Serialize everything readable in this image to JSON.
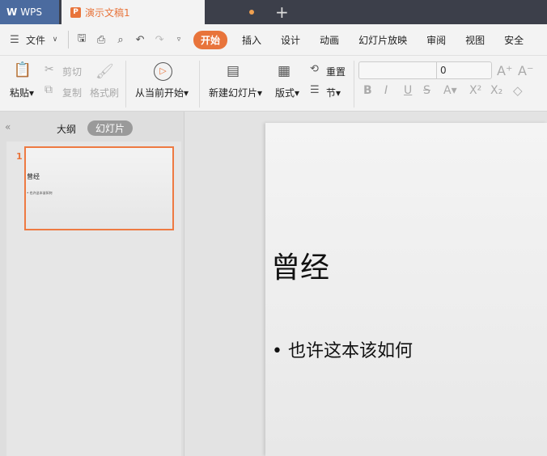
{
  "tabs": {
    "app": "WPS",
    "document": "演示文稿1",
    "new_tab": "+"
  },
  "menu": {
    "file": "文件",
    "items": [
      "开始",
      "插入",
      "设计",
      "动画",
      "幻灯片放映",
      "审阅",
      "视图",
      "安全"
    ]
  },
  "ribbon": {
    "paste": "粘贴",
    "cut": "剪切",
    "copy": "复制",
    "format_painter": "格式刷",
    "play_from_current": "从当前开始",
    "new_slide": "新建幻灯片",
    "layout": "版式",
    "reset": "重置",
    "section": "节",
    "font_name": "",
    "font_size": "0"
  },
  "panel": {
    "outline_tab": "大纲",
    "slides_tab": "幻灯片",
    "slide_number": "1"
  },
  "slide": {
    "title": "曾经",
    "bullet": "也许这本该如何"
  },
  "colors": {
    "accent": "#e8743b",
    "wps_blue": "#4b6b9f"
  }
}
